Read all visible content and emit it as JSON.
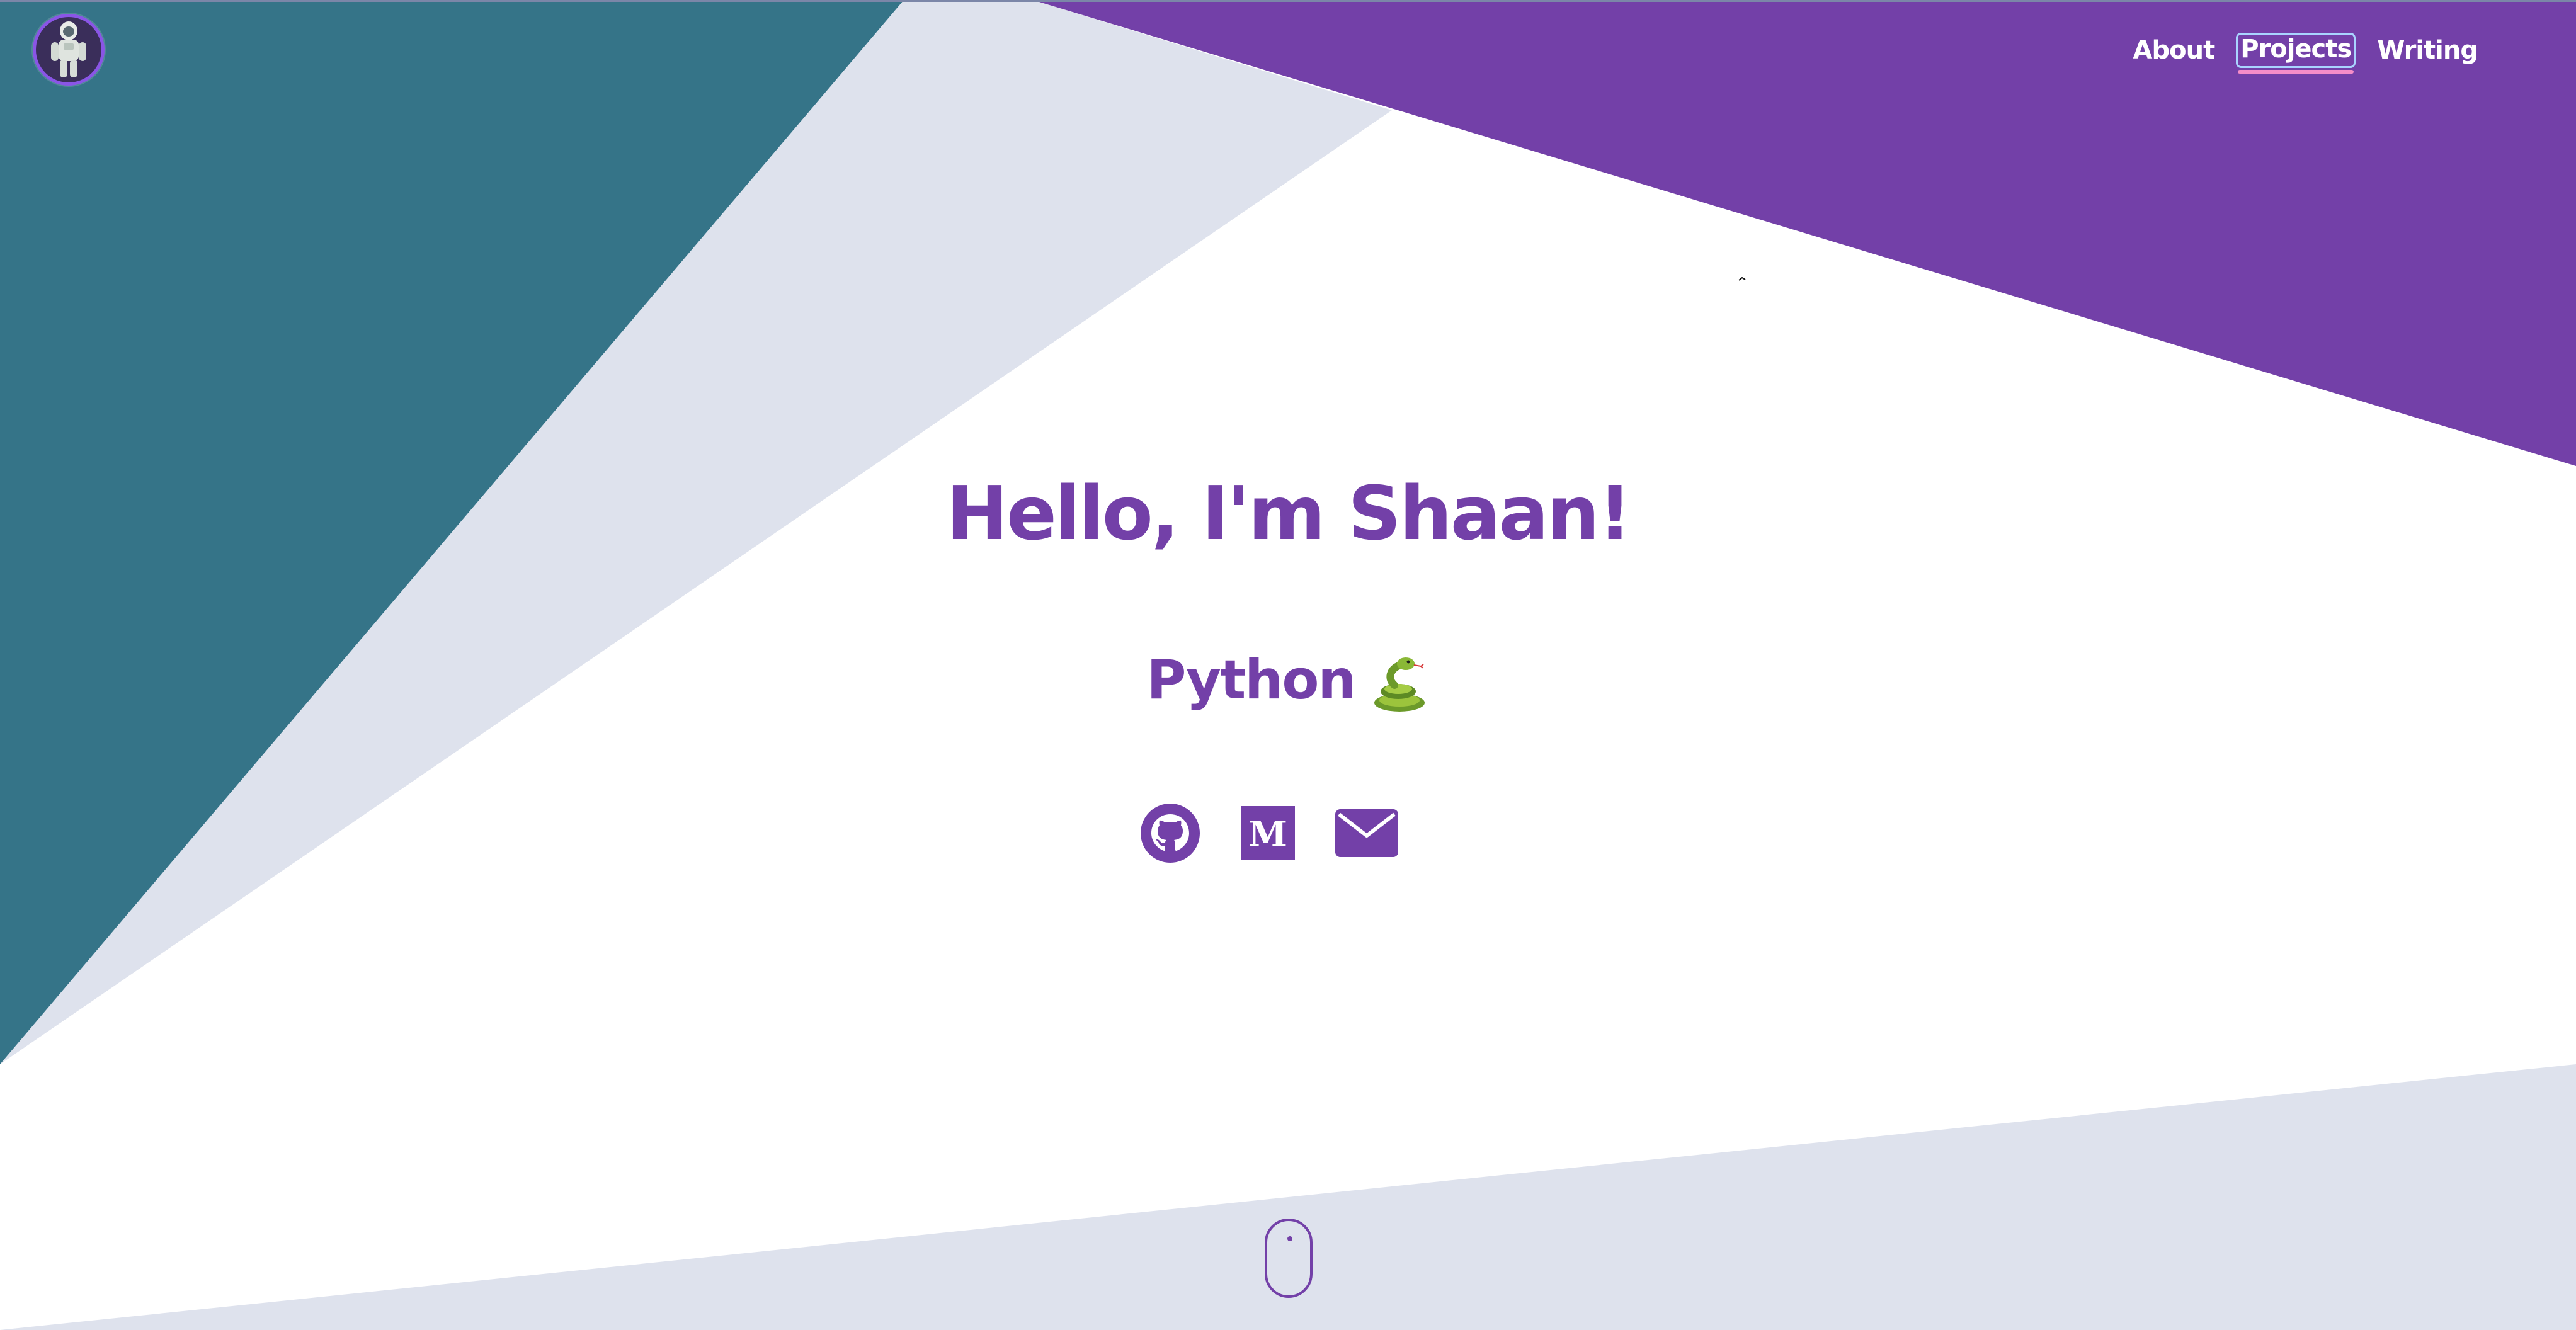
{
  "header": {
    "logo_icon": "astronaut-icon",
    "nav": [
      {
        "label": "About",
        "active": false
      },
      {
        "label": "Projects",
        "active": true
      },
      {
        "label": "Writing",
        "active": false
      }
    ]
  },
  "hero": {
    "title": "Hello, I'm Shaan!",
    "subtitle": "Python",
    "subtitle_icon": "snake-emoji-icon"
  },
  "socials": [
    {
      "name": "github",
      "icon": "github-icon"
    },
    {
      "name": "medium",
      "icon": "medium-icon"
    },
    {
      "name": "email",
      "icon": "mail-icon"
    }
  ],
  "scroll_indicator": {
    "icon": "mouse-scroll-icon"
  },
  "colors": {
    "teal": "#357488",
    "purple": "#7340a8",
    "light_gray": "#dee2ed",
    "white": "#ffffff",
    "active_underline": "#f58dc8"
  }
}
